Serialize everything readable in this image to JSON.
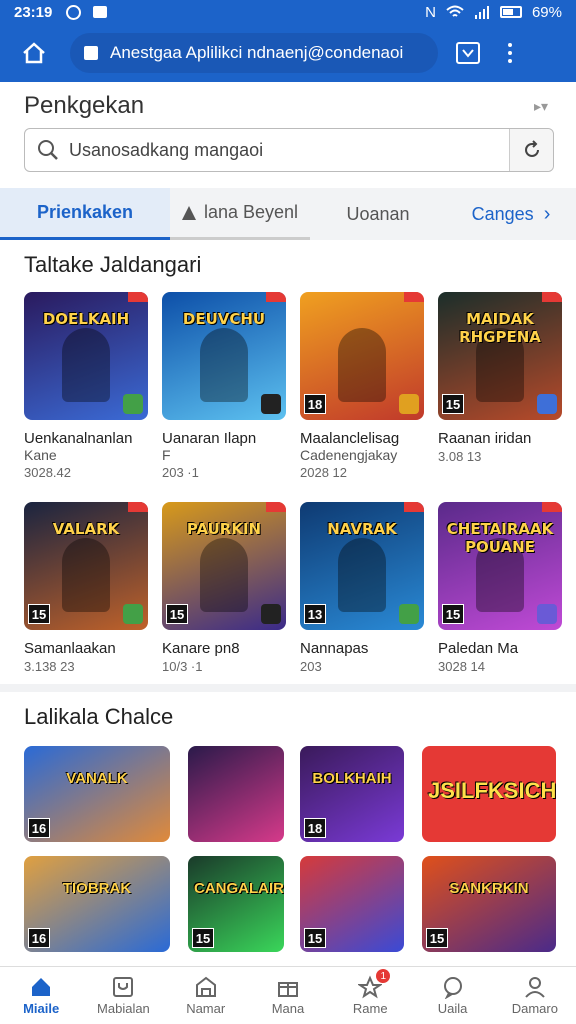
{
  "status": {
    "time": "23:19",
    "battery": "69%"
  },
  "appbar": {
    "url_text": "Anestgaa Aplilikci ndnaenj@condenaoi"
  },
  "search": {
    "title": "Penkgekan",
    "placeholder": "Usanosadkang mangaoi"
  },
  "tabs": [
    {
      "label": "Prienkaken"
    },
    {
      "label": "lana Beyenl"
    },
    {
      "label": "Uoanan"
    },
    {
      "label": "Canges"
    }
  ],
  "section1": {
    "title": "Taltake Jaldangari",
    "items": [
      {
        "art": "DOELKAIH",
        "name": "Uenkanalnanlan",
        "sub": "Kane",
        "meta": "3028.42",
        "rating": "",
        "colors": [
          "#2a1a5e",
          "#3b6bd6"
        ],
        "badge": "#43a047"
      },
      {
        "art": "DEUVCHU",
        "name": "Uanaran Ilapn",
        "sub": "F",
        "meta": "203 ·1",
        "rating": "",
        "colors": [
          "#0d4fa8",
          "#5dc1f0"
        ],
        "badge": "#222"
      },
      {
        "art": "",
        "name": "Maalanclelisag",
        "sub": "Cadenengjakay",
        "meta": "2028 12",
        "rating": "18",
        "colors": [
          "#f0a020",
          "#c0392b"
        ],
        "badge": "#e0a020"
      },
      {
        "art": "MAIDAK RHGPENA",
        "name": "Raanan iridan",
        "sub": "",
        "meta": "3.08 13",
        "rating": "15",
        "colors": [
          "#1b2e2a",
          "#b84a2a"
        ],
        "badge": "#3e6fd8"
      },
      {
        "art": "VALARK",
        "name": "Samanlaakan",
        "sub": "",
        "meta": "3.138 23",
        "rating": "15",
        "colors": [
          "#1a2440",
          "#c0622a"
        ],
        "badge": "#43a047"
      },
      {
        "art": "PAURKIN",
        "name": "Kanare pn8",
        "sub": "",
        "meta": "10/3 ·1",
        "rating": "15",
        "colors": [
          "#d89a1a",
          "#3a2a8a"
        ],
        "badge": "#222"
      },
      {
        "art": "NAVRAK",
        "name": "Nannapas",
        "sub": "",
        "meta": "203",
        "rating": "13",
        "colors": [
          "#0e3a72",
          "#2a8ad6"
        ],
        "badge": "#43a047"
      },
      {
        "art": "CHETAIRAAK POUANE",
        "name": "Paledan Ma",
        "sub": "",
        "meta": "3028 14",
        "rating": "15",
        "colors": [
          "#5a2a8a",
          "#c04ad6"
        ],
        "badge": "#6a5ad6"
      }
    ]
  },
  "section2": {
    "title": "Lalikala Chalce",
    "items": [
      {
        "art": "VANALK",
        "rating": "16",
        "colors": [
          "#2a6ad6",
          "#e08a3a"
        ]
      },
      {
        "art": "",
        "rating": "",
        "colors": [
          "#2a1a4a",
          "#d63a8a"
        ]
      },
      {
        "art": "BOLKHAIH",
        "rating": "18",
        "colors": [
          "#3a1a5a",
          "#7a3ad6"
        ]
      },
      {
        "art": "JSILFKSICH",
        "rating": "",
        "colors": [
          "#e53935",
          "#e53935"
        ]
      },
      {
        "art": "TIOBRAK",
        "rating": "16",
        "colors": [
          "#e0a040",
          "#2a6ad6"
        ]
      },
      {
        "art": "CANGALAIR",
        "rating": "15",
        "colors": [
          "#1a3a2a",
          "#3ad65a"
        ]
      },
      {
        "art": "",
        "rating": "15",
        "colors": [
          "#d63a3a",
          "#3a4ad6"
        ]
      },
      {
        "art": "SANKRKIN",
        "rating": "15",
        "colors": [
          "#e0501a",
          "#4a2a8a"
        ]
      }
    ]
  },
  "bottomnav": [
    {
      "label": "Miaile",
      "icon": "home-icon",
      "active": true
    },
    {
      "label": "Mabialan",
      "icon": "library-icon",
      "active": false
    },
    {
      "label": "Namar",
      "icon": "store-icon",
      "active": false
    },
    {
      "label": "Mana",
      "icon": "gift-icon",
      "active": false
    },
    {
      "label": "Rame",
      "icon": "star-icon",
      "active": false,
      "badge": "1"
    },
    {
      "label": "Uaila",
      "icon": "chat-icon",
      "active": false
    },
    {
      "label": "Damaro",
      "icon": "profile-icon",
      "active": false
    }
  ]
}
